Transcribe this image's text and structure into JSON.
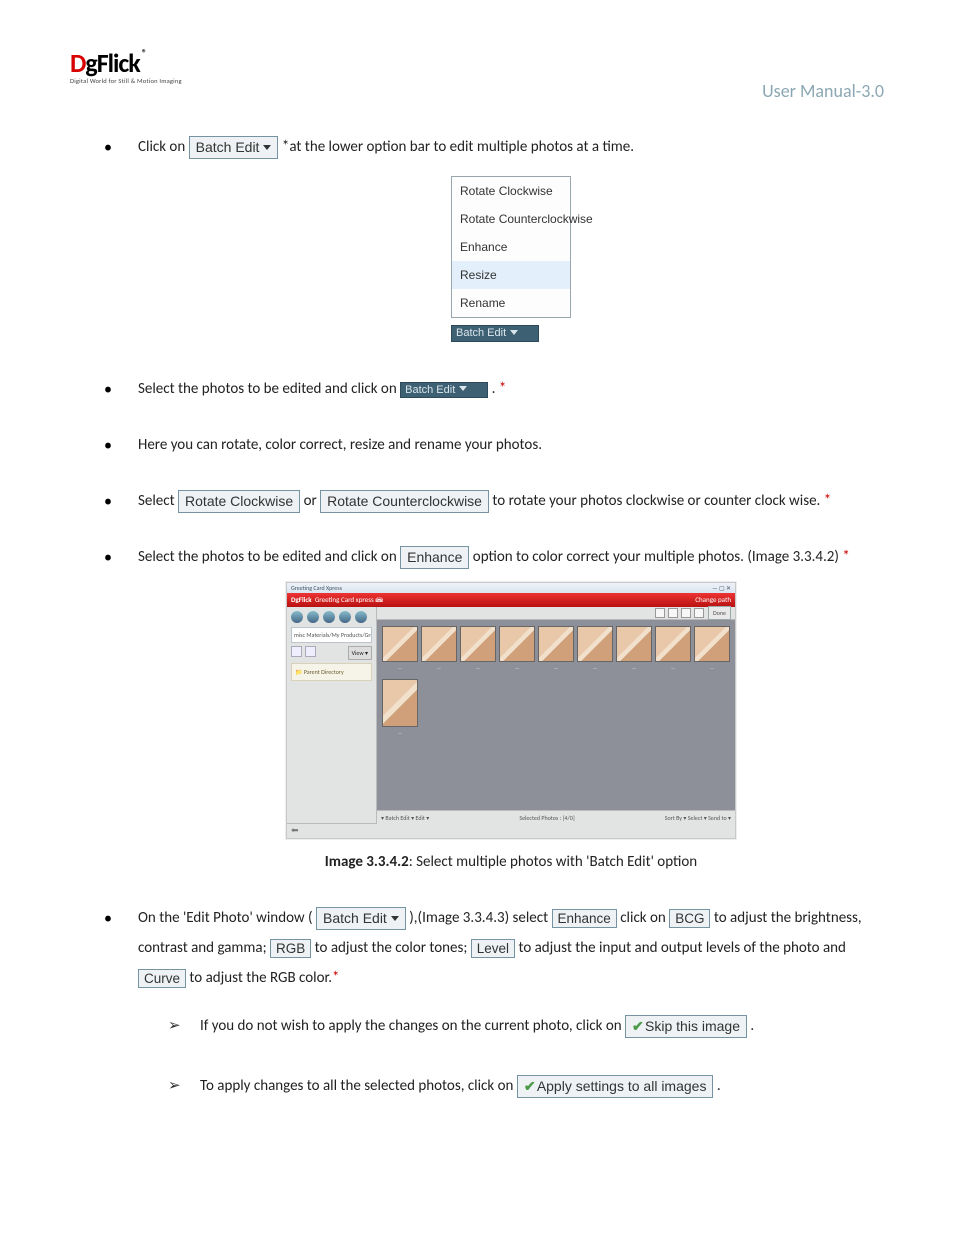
{
  "header": {
    "logo_d": "D",
    "logo_rest": "gFlick",
    "logo_reg": "®",
    "logo_tag": "Digital World for Still & Motion Imaging",
    "doc_title": "User Manual-3.0"
  },
  "buttons": {
    "batch_edit": "Batch Edit",
    "batch_edit_small": "Batch Edit",
    "rotate_cw": "Rotate Clockwise",
    "rotate_ccw": "Rotate Counterclockwise",
    "enhance": "Enhance",
    "bcg": "BCG",
    "rgb": "RGB",
    "level": "Level",
    "curve": "Curve",
    "skip_image": "Skip this image",
    "apply_all": "Apply settings to all images"
  },
  "menu": {
    "items": [
      "Rotate Clockwise",
      "Rotate Counterclockwise",
      "Enhance",
      "Resize",
      "Rename"
    ]
  },
  "bullets": {
    "b1a": "Click on ",
    "b1b": " *at the lower option bar to edit multiple photos at a time.",
    "b2a": "Select the photos to be edited and click on",
    "b2b": ".",
    "b3": "Here you can rotate, color correct, resize and rename your photos.",
    "b4a": "Select ",
    "b4or": " or ",
    "b4b": " to rotate your photos clockwise or counter clock wise. ",
    "b5a": "Select the photos to be edited and click on ",
    "b5b": " option to color correct your multiple photos. (Image 3.3.4.2) ",
    "b6a": "On the 'Edit Photo' window (",
    "b6b": "),(Image 3.3.4.3) select ",
    "b6c": " click on ",
    "b6d": " to adjust the brightness, contrast and gamma; ",
    "b6e": " to adjust the color tones; ",
    "b6f": " to adjust the input and output levels of the photo and ",
    "b6g": " to adjust the RGB color.",
    "c1a": "If you do not wish to apply the changes on the current photo, click on",
    "c1b": ".",
    "c2a": "To apply changes to all the selected photos, click on",
    "c2b": "."
  },
  "star": "*",
  "caption": {
    "bold": "Image 3.3.4.2",
    "rest": ": Select multiple photos with 'Batch Edit' option"
  },
  "screenshot": {
    "title": "Greeting Card Xpress",
    "brand": "DgFlick",
    "brand_sub": "Greeting Card xpress",
    "change_path": "Change path",
    "done": "Done",
    "path": "misc Materials/My Products/Greetings Pics",
    "parent": "Parent Directory",
    "selected": "Selected Photos :      [4/0]",
    "sort": "Sort By ▾   Select ▾   Send to ▾",
    "bottom_left": "▾ Batch Edit ▾   Edit  ▾"
  }
}
